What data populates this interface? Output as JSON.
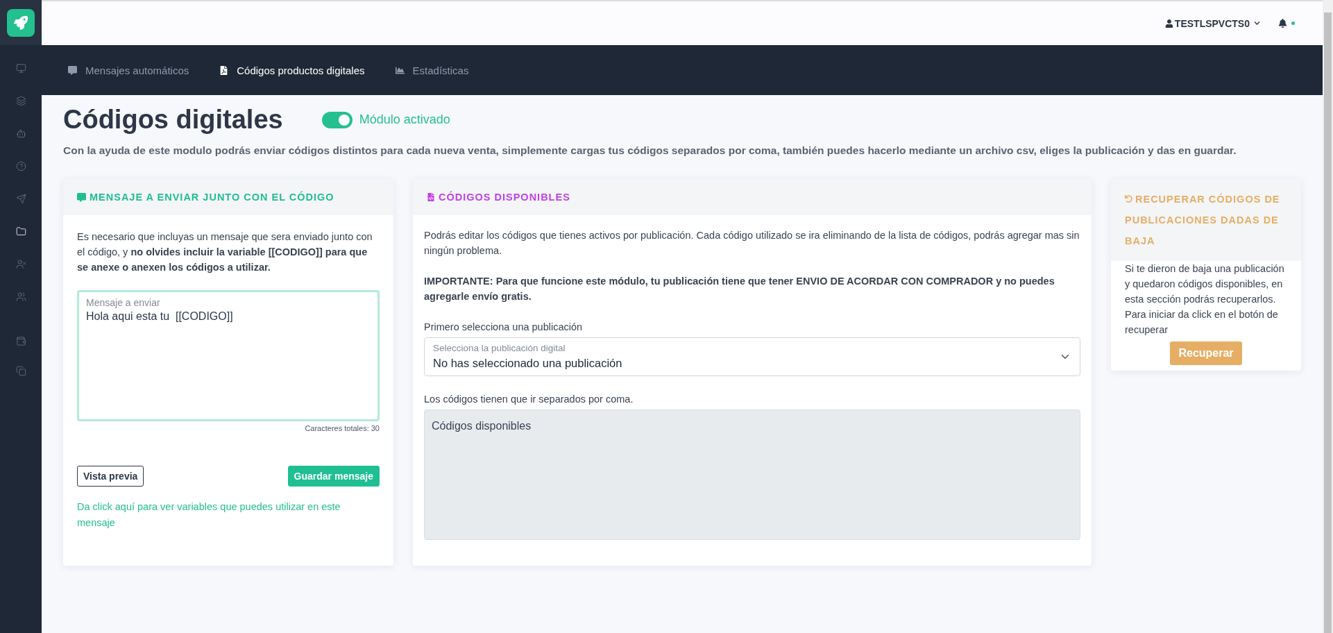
{
  "sidebar": {
    "items": [
      {
        "kind": "monitor",
        "selected": false
      },
      {
        "kind": "layers",
        "selected": false
      },
      {
        "kind": "robot",
        "selected": false
      },
      {
        "kind": "help",
        "selected": false
      },
      {
        "kind": "send",
        "selected": false
      },
      {
        "kind": "folder",
        "selected": true
      },
      {
        "kind": "user-x",
        "selected": false
      },
      {
        "kind": "users",
        "selected": false
      },
      {
        "kind": "wallet",
        "selected": false
      },
      {
        "kind": "copy",
        "selected": false
      }
    ]
  },
  "header": {
    "user": "TESTLSPVCTS0",
    "notifications_dot": true
  },
  "tabs": [
    {
      "kind": "message",
      "label": "Mensajes automáticos",
      "selected": false
    },
    {
      "kind": "file",
      "label": "Códigos productos digitales",
      "selected": true
    },
    {
      "kind": "chart",
      "label": "Estadísticas",
      "selected": false
    }
  ],
  "page": {
    "title": "Códigos digitales",
    "module_toggle": {
      "label": "Módulo activado",
      "on": true
    },
    "description": "Con la ayuda de este modulo podrás enviar códigos distintos para cada nueva venta, simplemente cargas tus códigos separados por coma, también puedes hacerlo mediante un archivo csv, eliges la publicación y das en guardar."
  },
  "message_card": {
    "title": "MENSAJE A ENVIAR JUNTO CON EL CÓDIGO",
    "intro": "Es necesario que incluyas un mensaje que sera enviado junto con el código, y **no olvides incluir la variable [[CODIGO]] para que se anexe o anexen los códigos a utilizar.**",
    "message_field": {
      "label": "Mensaje a enviar",
      "value": "Hola aqui esta tu  [[CODIGO]]"
    },
    "counter": "Caracteres totales: 30",
    "buttons": [
      {
        "kind": "outline",
        "label": "Vista previa"
      },
      {
        "kind": "primary",
        "label": "Guardar mensaje"
      }
    ],
    "variables_link": "Da click aquí para ver variables que puedes utilizar en este mensaje"
  },
  "codes_card": {
    "title": "CÓDIGOS DISPONIBLES",
    "intro": "Podrás editar los códigos que tienes activos por publicación. Cada código utilizado se ira eliminando de la lista de códigos, podrás agregar mas sin ningún problema.",
    "important": "IMPORTANTE: Para que funcione este módulo, tu publicación tiene que tener ENVIO DE ACORDAR CON COMPRADOR y no puedes agregarle envío gratis.",
    "select_heading": "Primero selecciona una publicación",
    "publication_select": {
      "label": "Selecciona la publicación digital",
      "value": "No has seleccionado una publicación"
    },
    "codes_heading": "Los códigos tienen que ir separados por coma.",
    "codes_field": {
      "placeholder": "Códigos disponibles",
      "disabled": true
    }
  },
  "recover_card": {
    "title": "RECUPERAR CÓDIGOS DE PUBLICACIONES DADAS DE BAJA",
    "text": "Si te dieron de baja una publicación y quedaron códigos disponibles, en esta sección podrás recuperarlos. Para iniciar da click en el botón de recuperar",
    "button": "Recuperar"
  }
}
